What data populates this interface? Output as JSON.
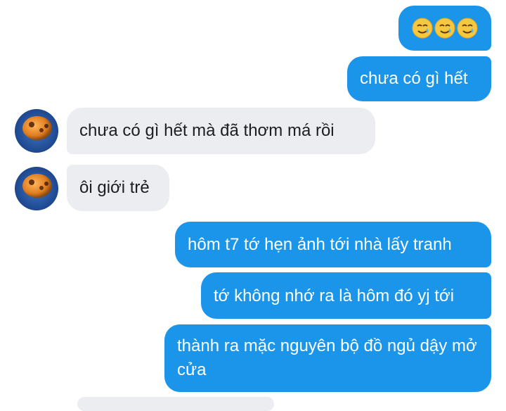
{
  "messages": [
    {
      "direction": "sent",
      "text": "",
      "emojis": [
        "smiling-face-with-tear-icon",
        "smiling-face-with-tear-icon",
        "smiling-face-with-tear-icon"
      ]
    },
    {
      "direction": "sent",
      "text": "chưa có gì hết"
    },
    {
      "direction": "received",
      "text": "chưa có gì hết mà đã thơm má rồi"
    },
    {
      "direction": "received",
      "text": "ôi giới trẻ"
    },
    {
      "direction": "sent",
      "text": "hôm t7 tớ hẹn ảnh tới nhà lấy tranh"
    },
    {
      "direction": "sent",
      "text": "tớ không nhớ ra là hôm đó yj tới"
    },
    {
      "direction": "sent",
      "text": "thành ra mặc nguyên bộ đồ ngủ dậy mở cửa"
    }
  ],
  "colors": {
    "sent_bubble": "#1a95ea",
    "sent_text": "#ffffff",
    "received_bubble": "#ebedf0",
    "received_text": "#1c1e21"
  }
}
